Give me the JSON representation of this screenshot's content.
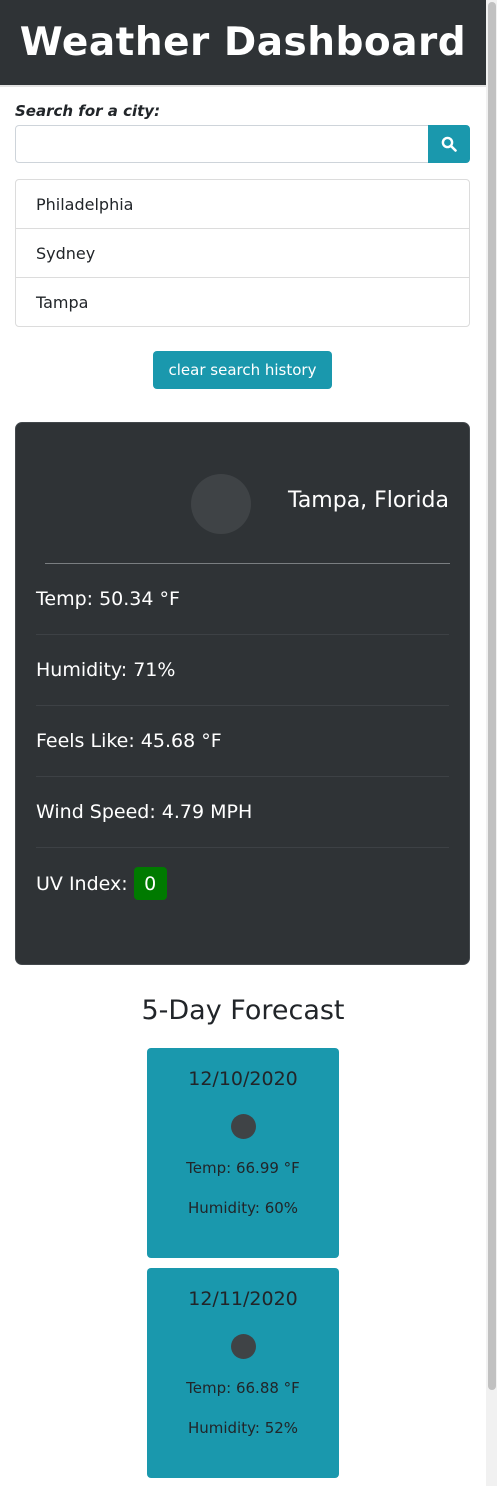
{
  "header": {
    "title": "Weather Dashboard"
  },
  "search": {
    "label": "Search for a city:",
    "value": "",
    "placeholder": "",
    "button_icon": "search-icon"
  },
  "history": {
    "items": [
      "Philadelphia",
      "Sydney",
      "Tampa"
    ],
    "clear_label": "clear search history"
  },
  "current": {
    "city": "Tampa, Florida",
    "icon": "weather-icon",
    "temp": "Temp: 50.34 °F",
    "humidity": "Humidity: 71%",
    "feels_like": "Feels Like: 45.68 °F",
    "wind_speed": "Wind Speed: 4.79 MPH",
    "uv_label": "UV Index:",
    "uv_value": "0",
    "uv_color": "#007a00"
  },
  "forecast": {
    "title": "5-Day Forecast",
    "days": [
      {
        "date": "12/10/2020",
        "temp": "Temp: 66.99 °F",
        "humidity": "Humidity: 60%"
      },
      {
        "date": "12/11/2020",
        "temp": "Temp: 66.88 °F",
        "humidity": "Humidity: 52%"
      }
    ]
  },
  "colors": {
    "header_bg": "#2f3336",
    "accent": "#1a98ad",
    "card_bg": "#2f3336"
  }
}
